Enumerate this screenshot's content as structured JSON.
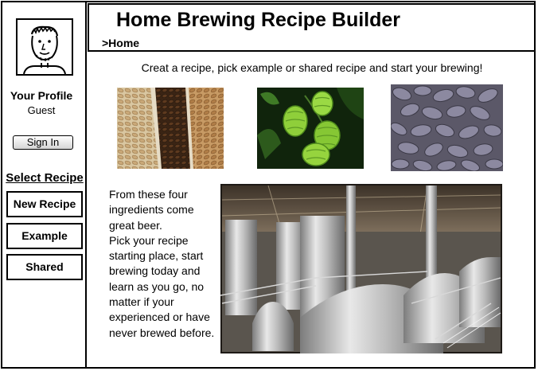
{
  "header": {
    "title": "Home Brewing Recipe Builder",
    "breadcrumb": ">Home"
  },
  "sidebar": {
    "profile_title": "Your Profile",
    "user_name": "Guest",
    "sign_in_label": "Sign In",
    "select_title": "Select Recipe",
    "items": [
      {
        "label": "New Recipe"
      },
      {
        "label": "Example"
      },
      {
        "label": "Shared"
      }
    ]
  },
  "main": {
    "tagline": "Creat a recipe, pick example or shared recipe and start your brewing!",
    "ingredients": [
      {
        "name": "grain-image"
      },
      {
        "name": "hops-image"
      },
      {
        "name": "yeast-image"
      }
    ],
    "body_lines": [
      "From these four",
      "ingredients come",
      "great beer.",
      "Pick your recipe",
      "starting place, start",
      "brewing today and",
      "learn as you go, no",
      "matter if your",
      "experienced or have",
      "never brewed before."
    ]
  }
}
